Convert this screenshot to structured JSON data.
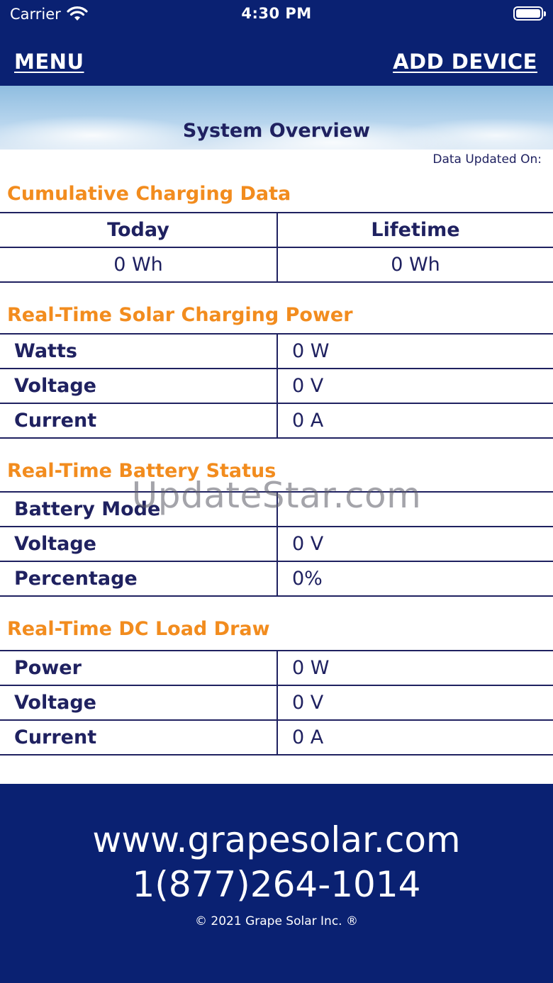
{
  "status_bar": {
    "carrier": "Carrier",
    "time": "4:30 PM"
  },
  "nav": {
    "menu": "MENU",
    "add_device": "ADD DEVICE"
  },
  "banner": {
    "title": "System Overview"
  },
  "data_updated": "Data Updated On:",
  "cumulative": {
    "title": "Cumulative Charging Data",
    "headers": [
      "Today",
      "Lifetime"
    ],
    "values": [
      "0 Wh",
      "0 Wh"
    ]
  },
  "solar": {
    "title": "Real-Time Solar Charging Power",
    "rows": [
      {
        "label": "Watts",
        "value": "0 W"
      },
      {
        "label": "Voltage",
        "value": "0 V"
      },
      {
        "label": "Current",
        "value": "0 A"
      }
    ]
  },
  "battery": {
    "title": "Real-Time Battery Status",
    "rows": [
      {
        "label": "Battery Mode",
        "value": ""
      },
      {
        "label": "Voltage",
        "value": "0 V"
      },
      {
        "label": "Percentage",
        "value": "0%"
      }
    ]
  },
  "load": {
    "title": "Real-Time DC Load Draw",
    "rows": [
      {
        "label": "Power",
        "value": "0 W"
      },
      {
        "label": "Voltage",
        "value": "0 V"
      },
      {
        "label": "Current",
        "value": "0 A"
      }
    ]
  },
  "watermark": "UpdateStar.com",
  "footer": {
    "website": "www.grapesolar.com",
    "phone": "1(877)264-1014",
    "copyright": "© 2021 Grape Solar Inc. ®"
  },
  "colors": {
    "navy": "#0a2172",
    "orange": "#f28c1e",
    "text": "#1f2160"
  }
}
